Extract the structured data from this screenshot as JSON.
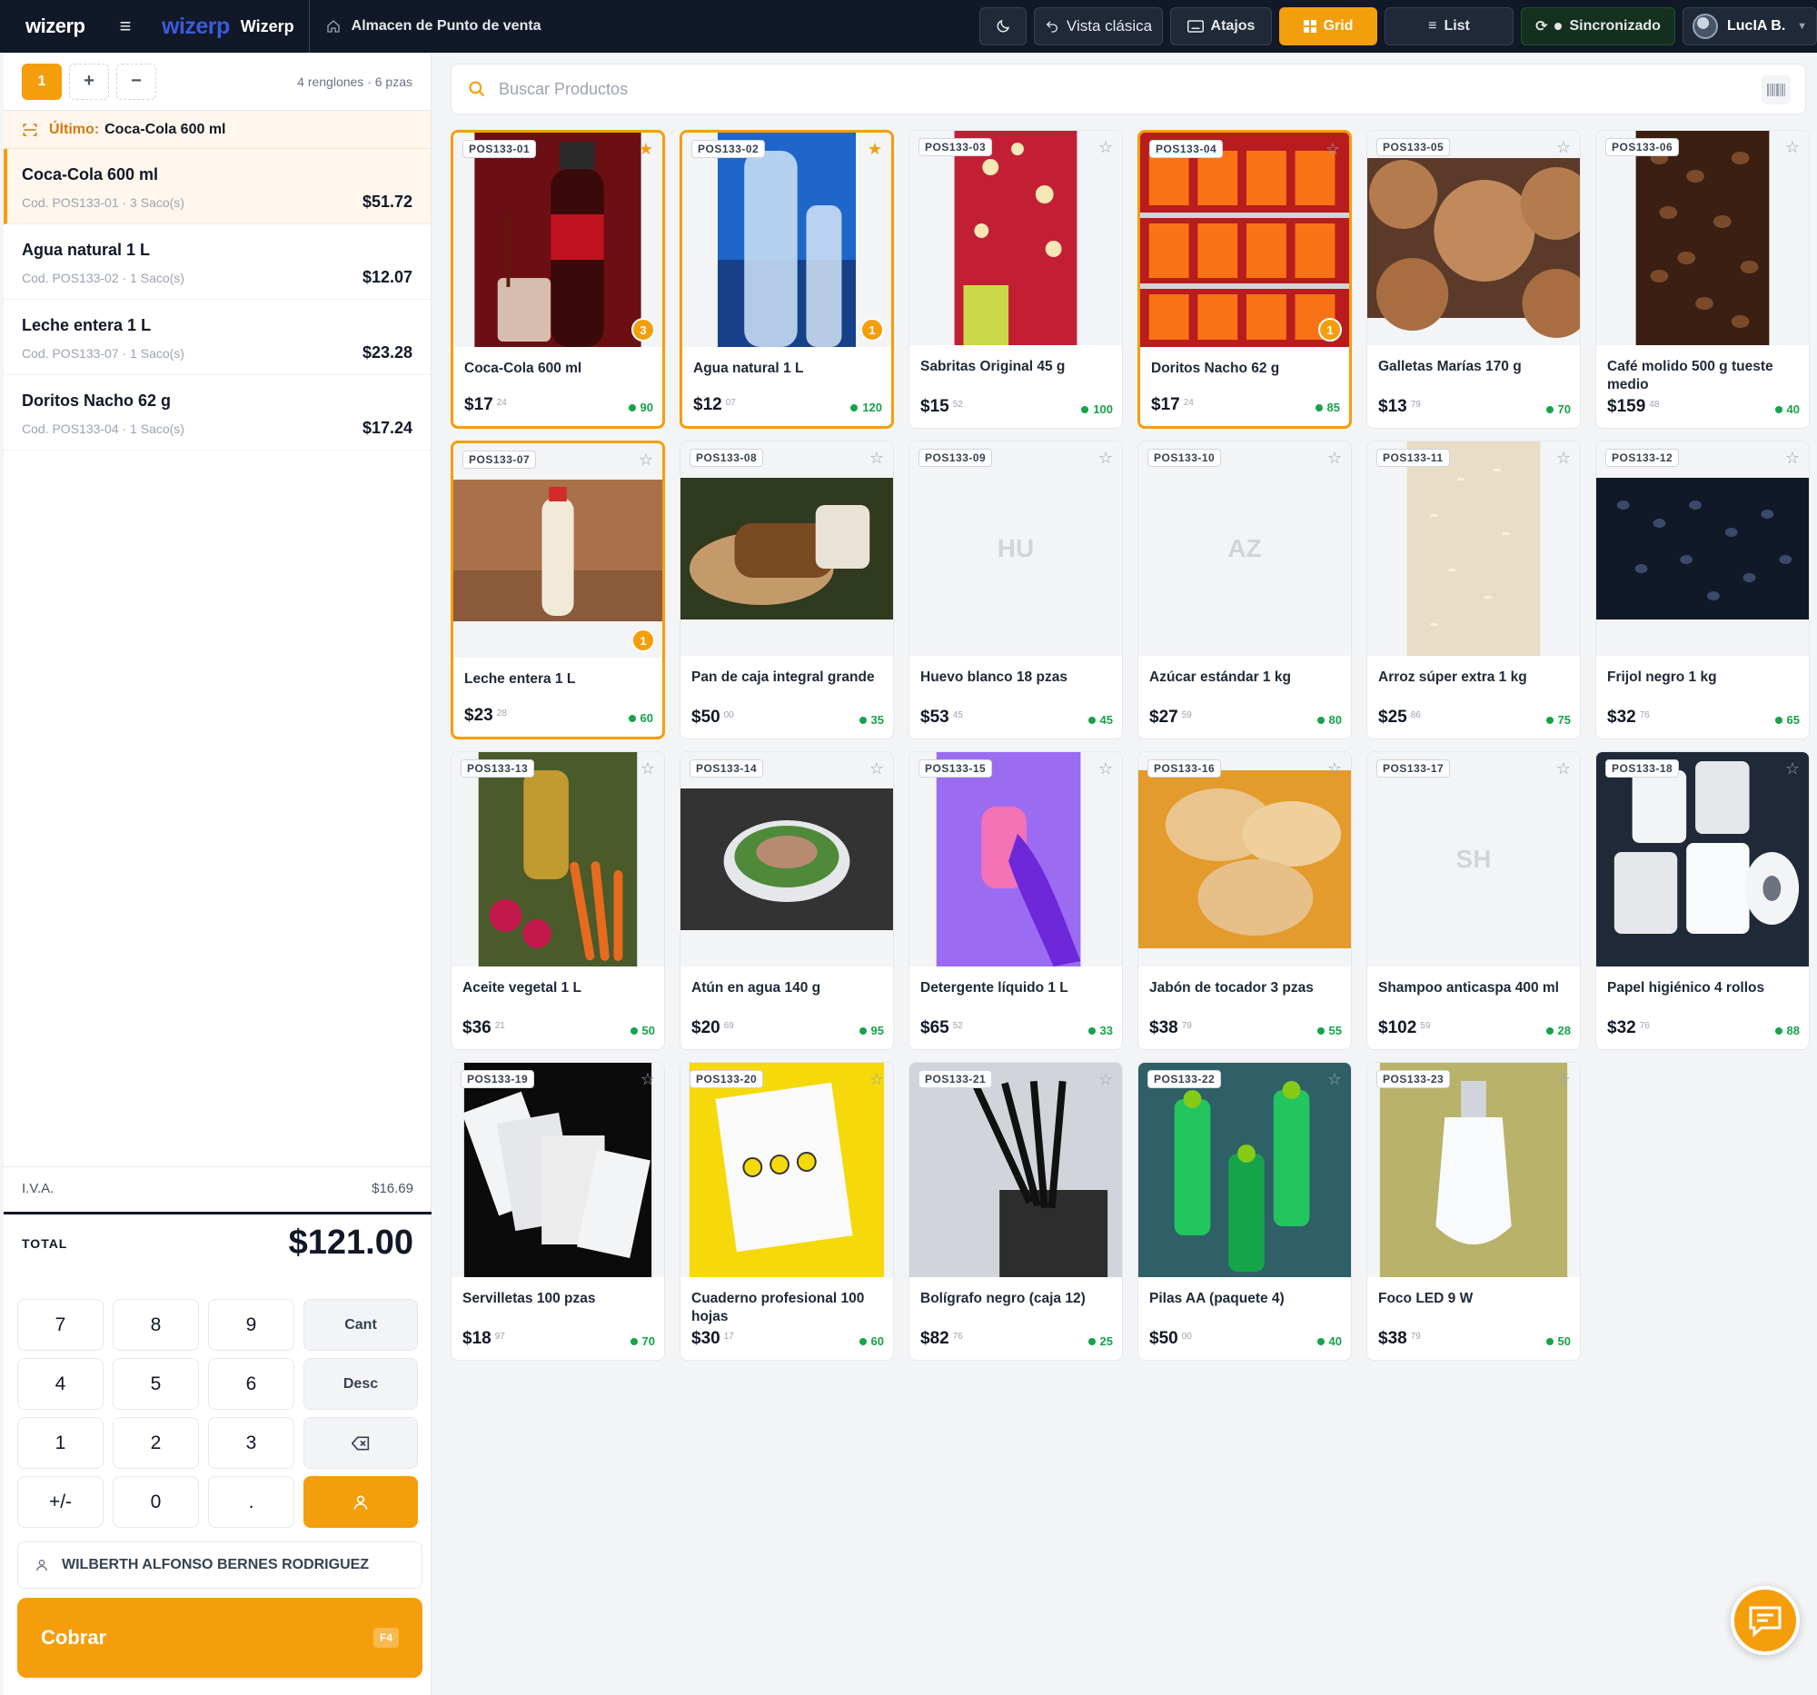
{
  "topbar": {
    "logo": "wizerp",
    "logo_tag": "",
    "brand": "Wizerp",
    "store": "Almacen de Punto de venta",
    "vista_clasica": "Vista clásica",
    "atajos": "Atajos",
    "grid": "Grid",
    "list": "List",
    "sync": "Sincronizado",
    "user": "LucIA B."
  },
  "ticket": {
    "active_tab": "1",
    "count": "4 renglones · 6 pzas",
    "last_label": "Último:",
    "last_value": "Coca-Cola 600 ml",
    "items": [
      {
        "name": "Coca-Cola 600 ml",
        "sub": "Cod. POS133-01 · 3 Saco(s)",
        "price": "$51.72"
      },
      {
        "name": "Agua natural 1 L",
        "sub": "Cod. POS133-02 · 1 Saco(s)",
        "price": "$12.07"
      },
      {
        "name": "Leche entera 1 L",
        "sub": "Cod. POS133-07 · 1 Saco(s)",
        "price": "$23.28"
      },
      {
        "name": "Doritos Nacho 62 g",
        "sub": "Cod. POS133-04 · 1 Saco(s)",
        "price": "$17.24"
      }
    ],
    "iva_label": "I.V.A.",
    "iva_value": "$16.69",
    "total_label": "TOTAL",
    "total_value": "$121.00"
  },
  "keypad": {
    "k7": "7",
    "k8": "8",
    "k9": "9",
    "cant": "Cant",
    "k4": "4",
    "k5": "5",
    "k6": "6",
    "desc": "Desc",
    "k1": "1",
    "k2": "2",
    "k3": "3",
    "pm": "+/-",
    "k0": "0",
    "dot": "."
  },
  "customer": "WILBERTH ALFONSO BERNES RODRIGUEZ",
  "cobrar": {
    "label": "Cobrar",
    "key": "F4"
  },
  "search": {
    "placeholder": "Buscar Productos"
  },
  "products": [
    {
      "code": "POS133-01",
      "name": "Coca-Cola 600 ml",
      "price": "$17",
      "cents": "24",
      "stock": "90",
      "qty": "3",
      "fav": true
    },
    {
      "code": "POS133-02",
      "name": "Agua natural 1 L",
      "price": "$12",
      "cents": "07",
      "stock": "120",
      "qty": "1",
      "fav": true
    },
    {
      "code": "POS133-03",
      "name": "Sabritas Original 45 g",
      "price": "$15",
      "cents": "52",
      "stock": "100"
    },
    {
      "code": "POS133-04",
      "name": "Doritos Nacho 62 g",
      "price": "$17",
      "cents": "24",
      "stock": "85",
      "qty": "1"
    },
    {
      "code": "POS133-05",
      "name": "Galletas Marías 170 g",
      "price": "$13",
      "cents": "79",
      "stock": "70"
    },
    {
      "code": "POS133-06",
      "name": "Café molido 500 g tueste medio",
      "price": "$159",
      "cents": "48",
      "stock": "40"
    },
    {
      "code": "POS133-07",
      "name": "Leche entera 1 L",
      "price": "$23",
      "cents": "28",
      "stock": "60",
      "qty": "1"
    },
    {
      "code": "POS133-08",
      "name": "Pan de caja integral grande",
      "price": "$50",
      "cents": "00",
      "stock": "35"
    },
    {
      "code": "POS133-09",
      "name": "Huevo blanco 18 pzas",
      "price": "$53",
      "cents": "45",
      "stock": "45",
      "initials": "HU"
    },
    {
      "code": "POS133-10",
      "name": "Azúcar estándar 1 kg",
      "price": "$27",
      "cents": "59",
      "stock": "80",
      "initials": "AZ"
    },
    {
      "code": "POS133-11",
      "name": "Arroz súper extra 1 kg",
      "price": "$25",
      "cents": "86",
      "stock": "75"
    },
    {
      "code": "POS133-12",
      "name": "Frijol negro 1 kg",
      "price": "$32",
      "cents": "76",
      "stock": "65"
    },
    {
      "code": "POS133-13",
      "name": "Aceite vegetal 1 L",
      "price": "$36",
      "cents": "21",
      "stock": "50"
    },
    {
      "code": "POS133-14",
      "name": "Atún en agua 140 g",
      "price": "$20",
      "cents": "69",
      "stock": "95"
    },
    {
      "code": "POS133-15",
      "name": "Detergente líquido 1 L",
      "price": "$65",
      "cents": "52",
      "stock": "33"
    },
    {
      "code": "POS133-16",
      "name": "Jabón de tocador 3 pzas",
      "price": "$38",
      "cents": "79",
      "stock": "55"
    },
    {
      "code": "POS133-17",
      "name": "Shampoo anticaspa 400 ml",
      "price": "$102",
      "cents": "59",
      "stock": "28",
      "initials": "SH"
    },
    {
      "code": "POS133-18",
      "name": "Papel higiénico 4 rollos",
      "price": "$32",
      "cents": "76",
      "stock": "88"
    },
    {
      "code": "POS133-19",
      "name": "Servilletas 100 pzas",
      "price": "$18",
      "cents": "97",
      "stock": "70"
    },
    {
      "code": "POS133-20",
      "name": "Cuaderno profesional 100 hojas",
      "price": "$30",
      "cents": "17",
      "stock": "60"
    },
    {
      "code": "POS133-21",
      "name": "Bolígrafo negro (caja 12)",
      "price": "$82",
      "cents": "76",
      "stock": "25"
    },
    {
      "code": "POS133-22",
      "name": "Pilas AA (paquete 4)",
      "price": "$50",
      "cents": "00",
      "stock": "40"
    },
    {
      "code": "POS133-23",
      "name": "Foco LED 9 W",
      "price": "$38",
      "cents": "79",
      "stock": "50"
    }
  ],
  "colors": {
    "accent": "#f59e0b",
    "topbar": "#111827",
    "stock_green": "#16a34a",
    "brand_blue": "#3b5bdb"
  }
}
